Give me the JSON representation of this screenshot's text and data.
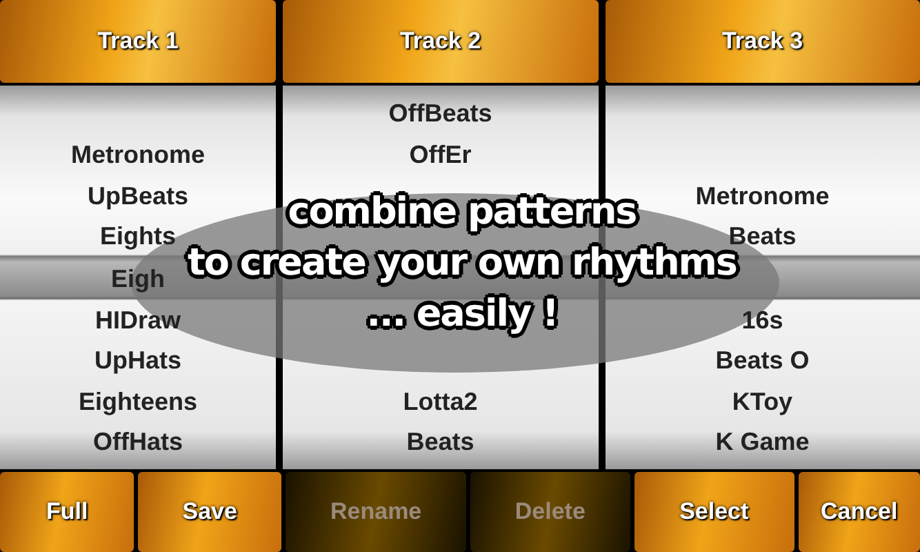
{
  "tracks": [
    {
      "title": "Track 1",
      "above_band": [
        "Metronome",
        "UpBeats",
        "Eights"
      ],
      "below": [
        "Eigh",
        "HIDraw",
        "UpHats",
        "Eighteens",
        "OffHats"
      ]
    },
    {
      "title": "Track 2",
      "top": [
        "OffBeats",
        "OffEr"
      ],
      "below": [
        "Lotta2",
        "Beats"
      ]
    },
    {
      "title": "Track 3",
      "above_band": [
        "Metronome",
        "Beats"
      ],
      "below": [
        "16s",
        "Beats O",
        "KToy",
        "K Game"
      ]
    }
  ],
  "caption": [
    "combine patterns",
    "to create your own rhythms",
    "... easily !"
  ],
  "buttons": [
    {
      "label": "Full",
      "disabled": false
    },
    {
      "label": "Save",
      "disabled": false
    },
    {
      "label": "Rename",
      "disabled": true
    },
    {
      "label": "Delete",
      "disabled": true
    },
    {
      "label": "Select",
      "disabled": false
    },
    {
      "label": "Cancel",
      "disabled": false
    }
  ]
}
